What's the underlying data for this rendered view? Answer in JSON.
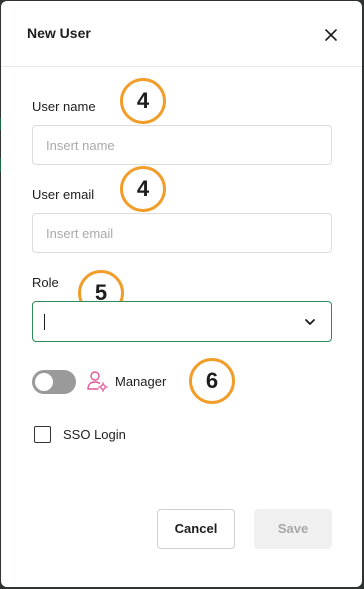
{
  "dialog": {
    "title": "New User",
    "close_icon": "close-icon"
  },
  "form": {
    "user_name": {
      "label": "User name",
      "placeholder": "Insert name",
      "value": ""
    },
    "user_email": {
      "label": "User email",
      "placeholder": "Insert email",
      "value": ""
    },
    "role": {
      "label": "Role",
      "value": "",
      "icon": "chevron-down-icon"
    },
    "manager": {
      "label": "Manager",
      "enabled": false,
      "icon": "user-settings-icon"
    },
    "sso": {
      "label": "SSO Login",
      "checked": false
    }
  },
  "annotations": {
    "name_marker": "4",
    "email_marker": "4",
    "role_marker": "5",
    "manager_marker": "6"
  },
  "footer": {
    "cancel_label": "Cancel",
    "save_label": "Save"
  },
  "colors": {
    "accent_green": "#2e8b57",
    "marker_orange": "#f29d2a",
    "manager_icon_pink": "#e0569a",
    "disabled_gray": "#f0f0f0"
  }
}
